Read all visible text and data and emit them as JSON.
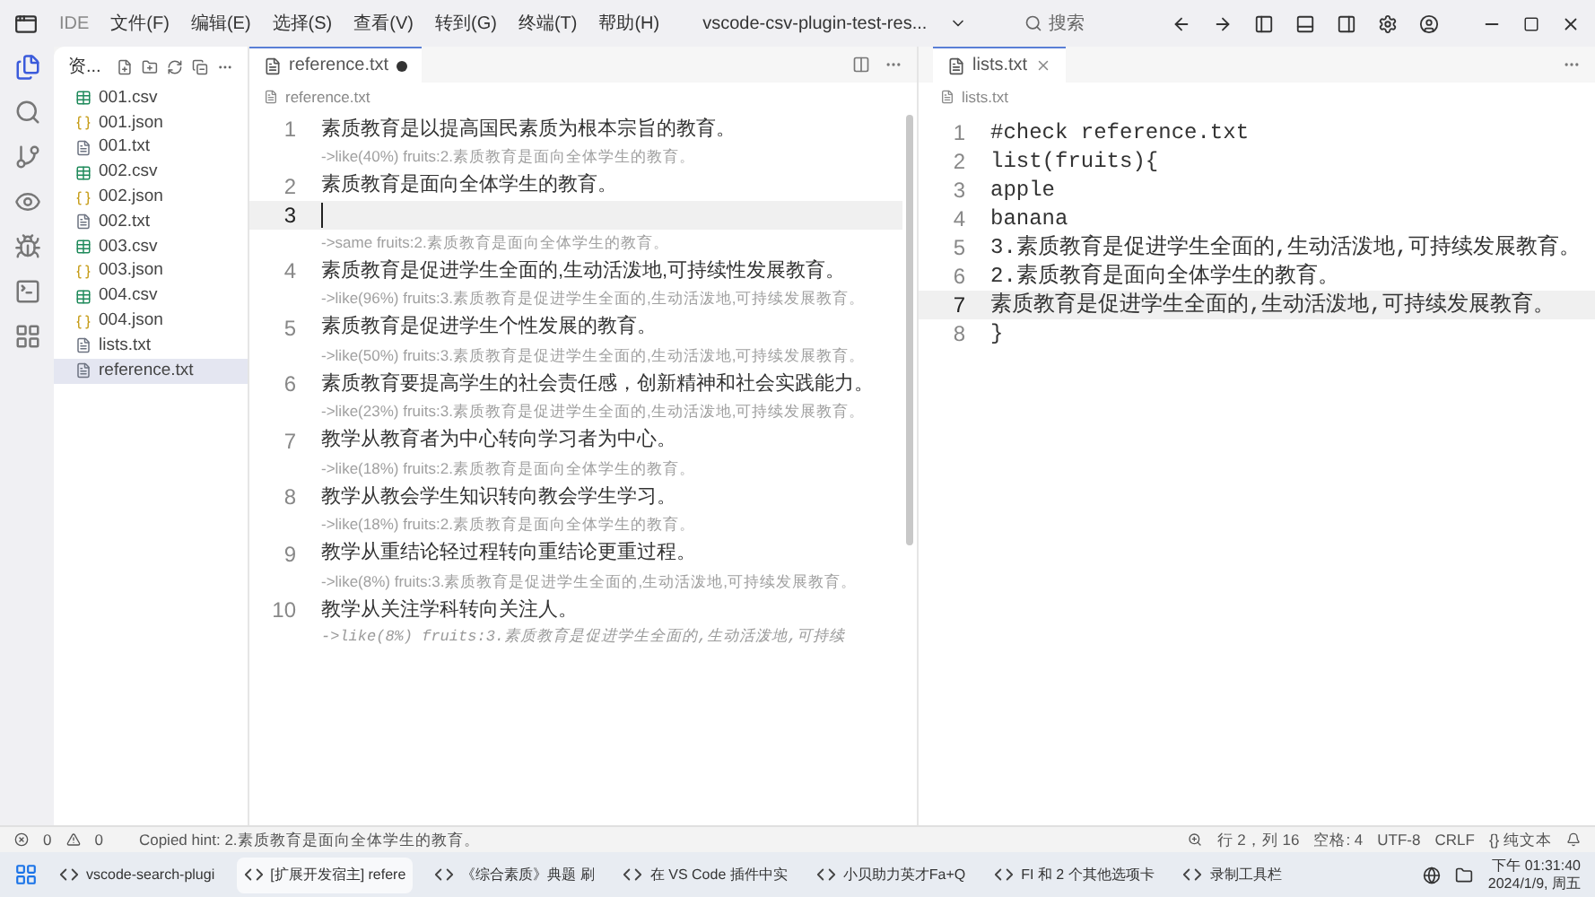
{
  "title_bar": {
    "app": "IDE",
    "menus": [
      "文件(F)",
      "编辑(E)",
      "选择(S)",
      "查看(V)",
      "转到(G)",
      "终端(T)",
      "帮助(H)"
    ],
    "workspace": "vscode-csv-plugin-test-res...",
    "search": "搜索"
  },
  "activity_bar": [
    {
      "kind": "files",
      "selected": true
    },
    {
      "kind": "search",
      "selected": false
    },
    {
      "kind": "git",
      "selected": false
    },
    {
      "kind": "eye",
      "selected": false
    },
    {
      "kind": "bug",
      "selected": false
    },
    {
      "kind": "terminal",
      "selected": false
    },
    {
      "kind": "grid",
      "selected": false
    }
  ],
  "explorer": {
    "title": "资...",
    "files": [
      {
        "name": "001.csv",
        "kind": "csv",
        "selected": false
      },
      {
        "name": "001.json",
        "kind": "json",
        "selected": false
      },
      {
        "name": "001.txt",
        "kind": "txt",
        "selected": false
      },
      {
        "name": "002.csv",
        "kind": "csv",
        "selected": false
      },
      {
        "name": "002.json",
        "kind": "json",
        "selected": false
      },
      {
        "name": "002.txt",
        "kind": "txt",
        "selected": false
      },
      {
        "name": "003.csv",
        "kind": "csv",
        "selected": false
      },
      {
        "name": "003.json",
        "kind": "json",
        "selected": false
      },
      {
        "name": "004.csv",
        "kind": "csv",
        "selected": false
      },
      {
        "name": "004.json",
        "kind": "json",
        "selected": false
      },
      {
        "name": "lists.txt",
        "kind": "txt",
        "selected": false
      },
      {
        "name": "reference.txt",
        "kind": "txt",
        "selected": true
      }
    ]
  },
  "left_editor": {
    "tab": {
      "label": "reference.txt",
      "modified": true
    },
    "breadcrumb": "reference.txt",
    "lines": [
      {
        "number": "1",
        "text": "素质教育是以提高国民素质为根本宗旨的教育。",
        "current": false,
        "annotation": {
          "kind": "hint",
          "text": "->like(40%) fruits:2.素质教育是面向全体学生的教育。"
        }
      },
      {
        "number": "2",
        "text": "素质教育是面向全体学生的教育。",
        "current": false
      },
      {
        "number": "3",
        "current": true,
        "annotation": {
          "kind": "hint",
          "text": "->same fruits:2.素质教育是面向全体学生的教育。"
        }
      },
      {
        "number": "4",
        "text": "素质教育是促进学生全面的,生动活泼地,可持续性发展教育。",
        "current": false,
        "annotation": {
          "kind": "hint",
          "text": "->like(96%) fruits:3.素质教育是促进学生全面的,生动活泼地,可持续发展教育。"
        }
      },
      {
        "number": "5",
        "text": "素质教育是促进学生个性发展的教育。",
        "current": false,
        "annotation": {
          "kind": "hint",
          "text": "->like(50%) fruits:3.素质教育是促进学生全面的,生动活泼地,可持续发展教育。"
        }
      },
      {
        "number": "6",
        "text": "素质教育要提高学生的社会责任感，创新精神和社会实践能力。",
        "current": false,
        "annotation": {
          "kind": "hint",
          "text": "->like(23%) fruits:3.素质教育是促进学生全面的,生动活泼地,可持续发展教育。"
        }
      },
      {
        "number": "7",
        "text": "教学从教育者为中心转向学习者为中心。",
        "current": false,
        "annotation": {
          "kind": "hint",
          "text": "->like(18%) fruits:2.素质教育是面向全体学生的教育。"
        }
      },
      {
        "number": "8",
        "text": "教学从教会学生知识转向教会学生学习。",
        "current": false,
        "annotation": {
          "kind": "hint",
          "text": "->like(18%) fruits:2.素质教育是面向全体学生的教育。"
        }
      },
      {
        "number": "9",
        "text": "教学从重结论轻过程转向重结论更重过程。",
        "current": false,
        "annotation": {
          "kind": "hint",
          "text": "->like(8%) fruits:3.素质教育是促进学生全面的,生动活泼地,可持续发展教育。"
        }
      },
      {
        "number": "10",
        "text": "教学从关注学科转向关注人。",
        "current": false,
        "annotation": {
          "kind": "inline",
          "text": "->like(8%) fruits:3.素质教育是促进学生全面的,生动活泼地,可持续"
        }
      }
    ]
  },
  "right_editor": {
    "tab": {
      "label": "lists.txt",
      "modified": false
    },
    "breadcrumb": "lists.txt",
    "lines": [
      {
        "number": "1",
        "text": "#check reference.txt",
        "current": false
      },
      {
        "number": "2",
        "text": "list(fruits){",
        "current": false
      },
      {
        "number": "3",
        "text": "apple",
        "current": false
      },
      {
        "number": "4",
        "text": "banana",
        "current": false
      },
      {
        "number": "5",
        "text": "3.素质教育是促进学生全面的,生动活泼地,可持续发展教育。",
        "current": false
      },
      {
        "number": "6",
        "text": "2.素质教育是面向全体学生的教育。",
        "current": false
      },
      {
        "number": "7",
        "text": "素质教育是促进学生全面的,生动活泼地,可持续发展教育。",
        "current": true
      },
      {
        "number": "8",
        "text": "}",
        "current": false
      }
    ]
  },
  "status_bar": {
    "errors": "0",
    "warnings": "0",
    "message": "Copied hint: 2.素质教育是面向全体学生的教育。",
    "items": [
      "行 2，列 16",
      "空格: 4",
      "UTF-8",
      "CRLF",
      "{} 纯文本"
    ]
  },
  "taskbar": {
    "apps": [
      {
        "label": "vscode-search-plugi",
        "selected": false
      },
      {
        "label": "[扩展开发宿主] refere",
        "selected": true
      },
      {
        "label": "《综合素质》典题 刷",
        "selected": false
      },
      {
        "label": "在 VS Code 插件中实",
        "selected": false
      },
      {
        "label": "小贝助力英才Fa+Q",
        "selected": false
      },
      {
        "label": "FI 和 2 个其他选项卡",
        "selected": false
      },
      {
        "label": "录制工具栏",
        "selected": false
      }
    ],
    "time": "下午 01:31:40",
    "date": "2024/1/9, 周五"
  }
}
